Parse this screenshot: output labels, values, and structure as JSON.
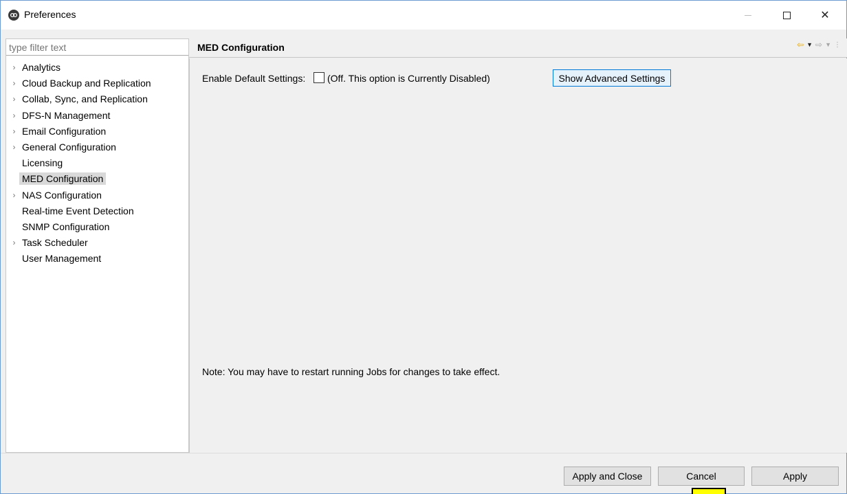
{
  "window": {
    "title": "Preferences",
    "icon": "app-logo-icon",
    "controls": {
      "minimize": "minimize-icon",
      "maximize": "maximize-icon",
      "close_glyph": "✕"
    }
  },
  "sidebar": {
    "filter_placeholder": "type filter text",
    "items": [
      {
        "label": "Analytics",
        "expandable": true
      },
      {
        "label": "Cloud Backup and Replication",
        "expandable": true
      },
      {
        "label": "Collab, Sync, and Replication",
        "expandable": true
      },
      {
        "label": "DFS-N Management",
        "expandable": true
      },
      {
        "label": "Email Configuration",
        "expandable": true
      },
      {
        "label": "General Configuration",
        "expandable": true
      },
      {
        "label": "Licensing",
        "expandable": false
      },
      {
        "label": "MED Configuration",
        "expandable": false,
        "selected": true
      },
      {
        "label": "NAS Configuration",
        "expandable": true
      },
      {
        "label": "Real-time Event Detection",
        "expandable": false
      },
      {
        "label": "SNMP Configuration",
        "expandable": false
      },
      {
        "label": "Task Scheduler",
        "expandable": true
      },
      {
        "label": "User Management",
        "expandable": false
      }
    ]
  },
  "main": {
    "title": "MED Configuration",
    "nav": {
      "back": "back-arrow-icon",
      "forward": "forward-arrow-icon",
      "menu": "view-menu-icon"
    },
    "enable_default_label": "Enable Default Settings:",
    "enable_default_checked": false,
    "enable_default_desc": "(Off. This option is Currently Disabled)",
    "advanced_button": "Show Advanced Settings",
    "note": "Note: You may have to restart running Jobs for changes to take effect."
  },
  "footer": {
    "apply_and_close": "Apply and Close",
    "cancel": "Cancel",
    "apply": "Apply"
  },
  "colors": {
    "window_border": "#6b9bd1",
    "selected_item_bg": "#d9d9d9",
    "focus_button_border": "#0078d7",
    "cursor_highlight": "#ffff00"
  }
}
